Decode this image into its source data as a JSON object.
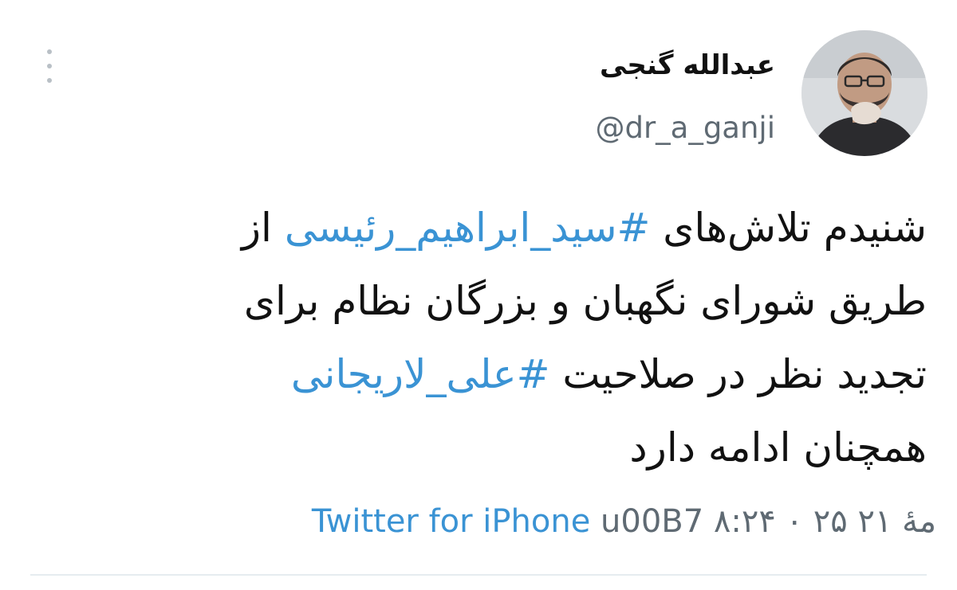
{
  "tweet": {
    "author": {
      "display_name": "عبدالله گنجی",
      "handle": "@dr_a_ganji"
    },
    "menu_icon": "more-vertical-icon",
    "lines": [
      [
        {
          "text": "شنیدم تلاش‌های ",
          "hashtag": false
        },
        {
          "text": "#سید_ابراهیم_رئیسی",
          "hashtag": true
        },
        {
          "text": " از",
          "hashtag": false
        }
      ],
      [
        {
          "text": "طریق شورای نگهبان و بزرگان نظام برای",
          "hashtag": false
        }
      ],
      [
        {
          "text": "تجدید نظر در صلاحیت ",
          "hashtag": false
        },
        {
          "text": "#علی_لاریجانی",
          "hashtag": true
        }
      ],
      [
        {
          "text": "همچنان ادامه دارد",
          "hashtag": false
        }
      ]
    ],
    "meta": {
      "time_date": "۸:۲۴ ۰ ۲۵ مهٔ ۲۱",
      "separator": "u00B7",
      "source": "Twitter for iPhone"
    },
    "colors": {
      "hashtag": "#3a93d4",
      "handle": "#5f6a73",
      "text": "#111111",
      "divider": "#e6ecf0"
    }
  }
}
